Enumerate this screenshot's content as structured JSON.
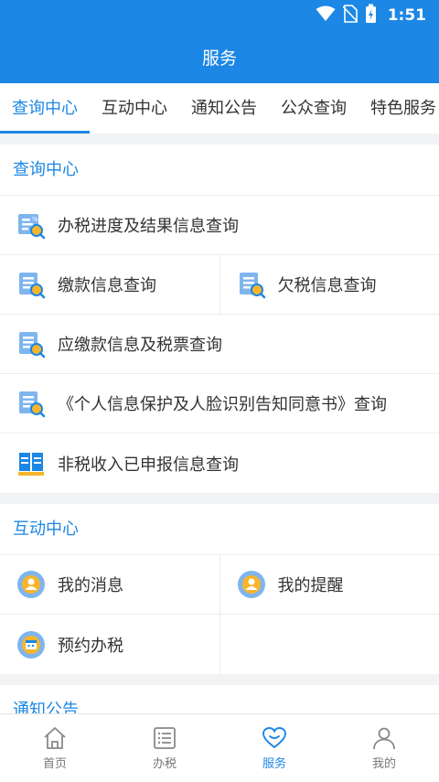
{
  "status_bar": {
    "time": "1:51",
    "icons": [
      "wifi-icon",
      "no-sim-icon",
      "battery-charging-icon"
    ]
  },
  "header": {
    "title": "服务"
  },
  "tabs": [
    {
      "label": "查询中心",
      "active": true
    },
    {
      "label": "互动中心",
      "active": false
    },
    {
      "label": "通知公告",
      "active": false
    },
    {
      "label": "公众查询",
      "active": false
    },
    {
      "label": "特色服务",
      "active": false
    }
  ],
  "sections": {
    "query": {
      "title": "查询中心",
      "items": [
        {
          "label": "办税进度及结果信息查询",
          "icon": "tax-progress-search-icon"
        },
        {
          "label": "缴款信息查询",
          "icon": "document-search-icon"
        },
        {
          "label": "欠税信息查询",
          "icon": "document-search-icon"
        },
        {
          "label": "应缴款信息及税票查询",
          "icon": "document-search-icon"
        },
        {
          "label": "《个人信息保护及人脸识别告知同意书》查询",
          "icon": "document-search-icon"
        },
        {
          "label": "非税收入已申报信息查询",
          "icon": "open-book-icon"
        }
      ]
    },
    "interact": {
      "title": "互动中心",
      "items": [
        {
          "label": "我的消息",
          "icon": "user-circle-icon"
        },
        {
          "label": "我的提醒",
          "icon": "user-circle-icon"
        },
        {
          "label": "预约办税",
          "icon": "calendar-circle-icon"
        }
      ]
    },
    "notice": {
      "title": "通知公告"
    }
  },
  "bottom_nav": [
    {
      "label": "首页",
      "icon": "home-icon",
      "active": false
    },
    {
      "label": "办税",
      "icon": "list-icon",
      "active": false
    },
    {
      "label": "服务",
      "icon": "heart-icon",
      "active": true
    },
    {
      "label": "我的",
      "icon": "person-icon",
      "active": false
    }
  ],
  "colors": {
    "primary": "#1c87e5",
    "accent_yellow": "#f7b52c",
    "background": "#f2f3f5"
  }
}
